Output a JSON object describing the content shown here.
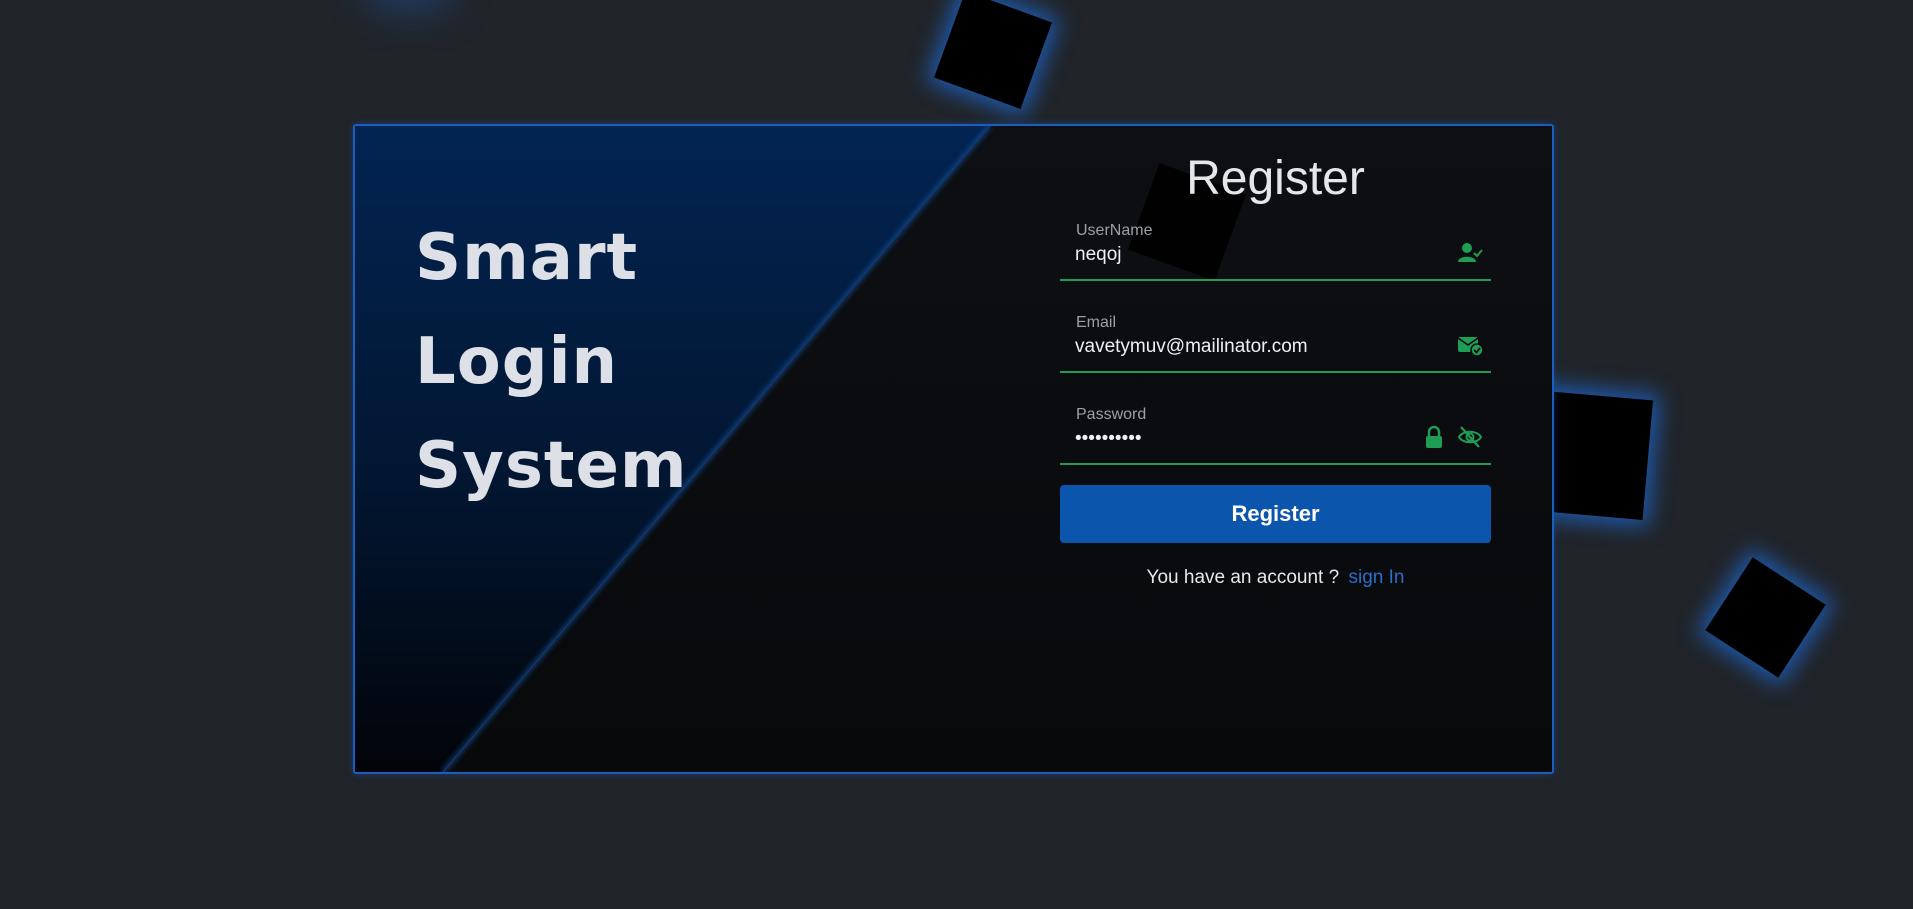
{
  "brand": {
    "lines": [
      "Smart",
      "Login",
      "System"
    ]
  },
  "form": {
    "title": "Register",
    "fields": [
      {
        "label": "UserName",
        "value": "neqoj",
        "icons": [
          "user-check-icon"
        ]
      },
      {
        "label": "Email",
        "value": "vavetymuv@mailinator.com",
        "icons": [
          "envelope-check-icon"
        ]
      },
      {
        "label": "Password",
        "value": "••••••••••",
        "icons": [
          "lock-icon",
          "eye-slash-icon"
        ]
      }
    ],
    "submit_label": "Register",
    "signin_text": "You have an account ?",
    "signin_link": "sign In"
  },
  "colors": {
    "accent": "#0c55ad",
    "valid": "#1f9d55",
    "link": "#2a6fc9",
    "background": "#212429"
  }
}
